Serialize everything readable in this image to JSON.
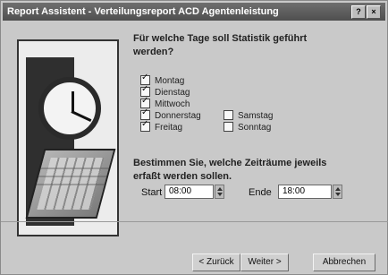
{
  "window": {
    "title": "Report Assistent - Verteilungsreport ACD Agentenleistung",
    "controls": [
      "?",
      "×"
    ]
  },
  "wizard": {
    "question1": "Für welche Tage soll Statistik geführt werden?",
    "question2": "Bestimmen Sie, welche Zeiträume jeweils erfaßt werden sollen.",
    "days": [
      {
        "label": "Montag",
        "checked": true
      },
      {
        "label": "Dienstag",
        "checked": true
      },
      {
        "label": "Mittwoch",
        "checked": true
      },
      {
        "label": "Donnerstag",
        "checked": true
      },
      {
        "label": "Freitag",
        "checked": true
      },
      {
        "label": "Samstag",
        "checked": false
      },
      {
        "label": "Sonntag",
        "checked": false
      }
    ],
    "start": {
      "label": "Start",
      "value": "08:00"
    },
    "end": {
      "label": "Ende",
      "value": "18:00"
    }
  },
  "buttons": {
    "back": "< Zurück",
    "next": "Weiter >",
    "cancel": "Abbrechen"
  }
}
